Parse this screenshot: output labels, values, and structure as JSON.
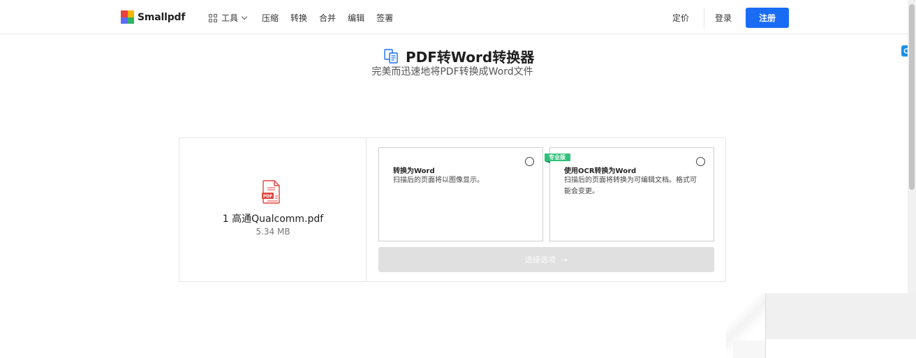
{
  "header": {
    "brand": "Smallpdf",
    "tools_label": "工具",
    "nav": [
      "压缩",
      "转换",
      "合并",
      "编辑",
      "签署"
    ],
    "pricing": "定价",
    "login": "登录",
    "signup": "注册",
    "brand_colors": [
      "#e8413c",
      "#f7b500",
      "#2fb463",
      "#5b6ef5"
    ],
    "accent": "#1a6cf5"
  },
  "main": {
    "title": "PDF转Word转换器",
    "subtitle": "完美而迅速地将PDF转换成Word文件"
  },
  "file": {
    "name": "1 高通Qualcomm.pdf",
    "size": "5.34 MB",
    "icon": "pdf-file-icon",
    "icon_color": "#e3423c"
  },
  "options": [
    {
      "title": "转换为Word",
      "desc": "扫描后的页面将以图像显示。",
      "badge": "",
      "selected": false
    },
    {
      "title": "使用OCR转换为Word",
      "desc": "扫描后的页面将转换为可编辑文档。格式可能会变更。",
      "badge": "专业版",
      "selected": false
    }
  ],
  "action": {
    "label": "选择选项",
    "arrow": "→",
    "disabled": true
  }
}
